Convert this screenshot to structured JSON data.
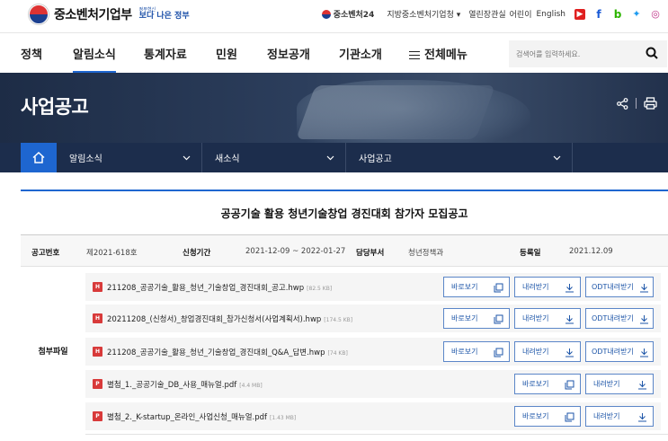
{
  "header": {
    "logo_text": "중소벤처기업부",
    "slogan_small": "정부혁신",
    "slogan_main": "보다 나은 정부",
    "links": [
      "중소벤처24",
      "지방중소벤처기업청 ▾",
      "열린장관실",
      "어린이",
      "English"
    ],
    "social": [
      "youtube-icon",
      "facebook-icon",
      "blog-icon",
      "twitter-icon",
      "instagram-icon"
    ]
  },
  "nav": {
    "items": [
      "정책",
      "알림소식",
      "통계자료",
      "민원",
      "정보공개",
      "기관소개",
      "전체메뉴"
    ],
    "active": "알림소식",
    "search_placeholder": "검색어를 입력하세요."
  },
  "banner": {
    "title": "사업공고"
  },
  "breadcrumb": {
    "items": [
      "알림소식",
      "새소식",
      "사업공고"
    ]
  },
  "post": {
    "title": "공공기술 활용 청년기술창업 경진대회 참가자 모집공고",
    "info": {
      "number_label": "공고번호",
      "number": "제2021-618호",
      "period_label": "신청기간",
      "period": "2021-12-09 ~ 2022-01-27",
      "dept_label": "담당부서",
      "dept": "청년정책과",
      "date_label": "등록일",
      "date": "2021.12.09"
    },
    "attachments_label": "첨부파일",
    "files": [
      {
        "name": "211208_공공기술_활용_청년_기술창업_경진대회_공고.hwp",
        "size": "[82.5 KB]",
        "odt": true
      },
      {
        "name": "20211208_(신청서)_창업경진대회_참가신청서(사업계획서).hwp",
        "size": "[174.5 KB]",
        "odt": true
      },
      {
        "name": "211208_공공기술_활용_청년_기술창업_경진대회_Q&A_답변.hwp",
        "size": "[74 KB]",
        "odt": true
      },
      {
        "name": "별첨_1._공공기술_DB_사용_매뉴얼.pdf",
        "size": "[4.4 MB]",
        "odt": false
      },
      {
        "name": "별첨_2._K-startup_온라인_사업신청_매뉴얼.pdf",
        "size": "[1.43 MB]",
        "odt": false
      }
    ],
    "buttons": {
      "view": "바로보기",
      "download": "내려받기",
      "odt": "ODT내려받기"
    }
  },
  "colors": {
    "accent": "#1e66d0",
    "navy": "#1c2d4c"
  }
}
